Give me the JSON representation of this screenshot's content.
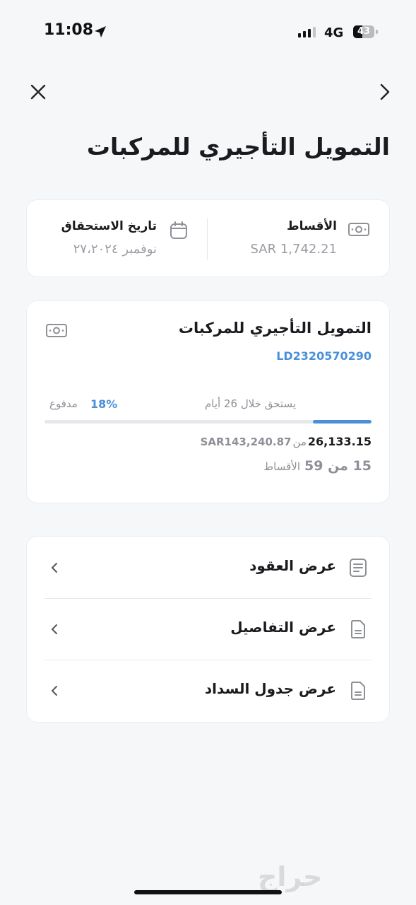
{
  "status_bar": {
    "time": "11:08",
    "network": "4G",
    "battery": "43",
    "battery_level": 0.43
  },
  "page": {
    "title": "التمويل التأجيري للمركبات"
  },
  "summary": {
    "installments_label": "الأقساط",
    "installments_value": "1,742.21 SAR",
    "due_date_label": "تاريخ الاستحقاق",
    "due_date_value": "نوفمبر ٢٧،٢٠٢٤"
  },
  "finance": {
    "title": "التمويل التأجيري للمركبات",
    "id": "LD2320570290",
    "due_text": "يستحق خلال 26 أيام",
    "percent": "18%",
    "percent_value": 18,
    "paid_label": "مدفوع",
    "amount_paid": "26,133.15",
    "of_label": "من",
    "amount_total": "SAR143,240.87",
    "installments_progress": "15 من 59",
    "installments_label": "الأقساط"
  },
  "actions": [
    {
      "label": "عرض العقود",
      "icon": "contract-icon"
    },
    {
      "label": "عرض التفاصيل",
      "icon": "document-icon"
    },
    {
      "label": "عرض جدول السداد",
      "icon": "document-icon"
    }
  ],
  "watermark": "حراج",
  "colors": {
    "accent": "#4a90d9",
    "background": "#f6f7f9",
    "card": "#ffffff"
  }
}
